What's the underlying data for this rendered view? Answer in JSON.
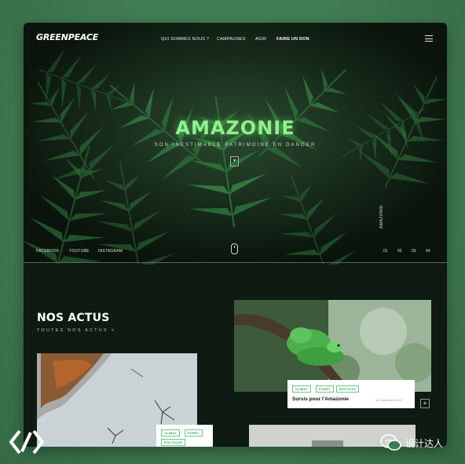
{
  "header": {
    "logo": "GREENPEACE",
    "nav": [
      "QUI SOMMES NOUS ?",
      "CAMPAGNES",
      "AGIR",
      "FAIRE UN DON"
    ]
  },
  "hero": {
    "title": "AMAZONIE",
    "subtitle": "SON INESTIMABLE PATRIMOINE EN DANGER",
    "button_icon": "▾",
    "social": [
      "FACEBOOK",
      "YOUTUBE",
      "INSTAGRAM"
    ],
    "vertical_label": "AMAZONIE",
    "pages": [
      "01",
      "02",
      "03",
      "04"
    ]
  },
  "news": {
    "heading": "NOS ACTUS",
    "link": "TOUTES NOS ACTUS +",
    "card_right": {
      "tags": [
        "CLIMAT",
        "FORÊT",
        "REPTILES"
      ],
      "title": "Sursis pour l'Amazonie",
      "date": "1er Septembre 2017"
    },
    "card_left": {
      "tags": [
        "CLIMAT",
        "FORÊT",
        "POLITIQUE"
      ]
    },
    "more_button": "+"
  },
  "watermark": {
    "text": "设计达人"
  },
  "colors": {
    "accent": "#8ff08f",
    "background": "#0f1a12",
    "outer": "#3f7a50"
  }
}
